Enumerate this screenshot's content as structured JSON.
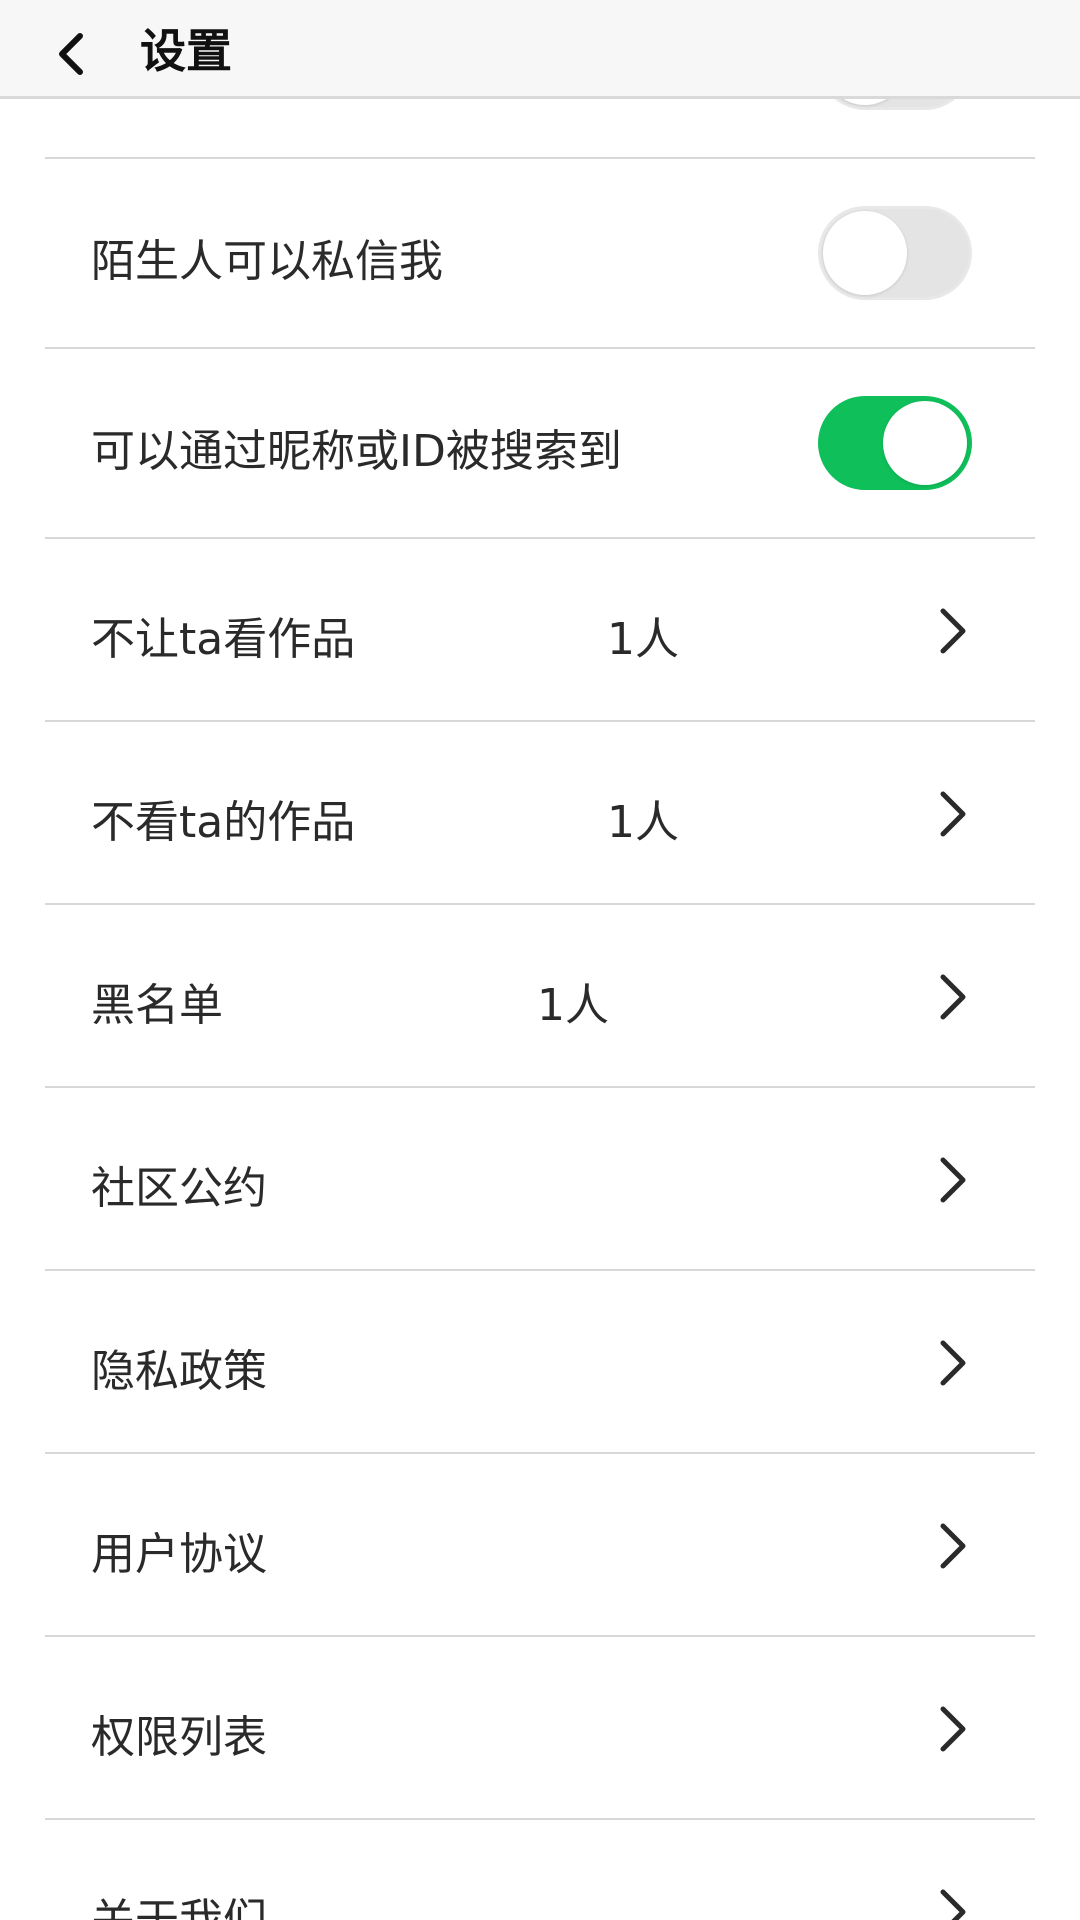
{
  "header": {
    "title": "设置"
  },
  "rows": {
    "stranger_dm": {
      "label": "陌生人可以私信我",
      "toggle": "off"
    },
    "searchable": {
      "label": "可以通过昵称或ID被搜索到",
      "toggle": "on"
    },
    "hide_works": {
      "label": "不让ta看作品",
      "value": "1人"
    },
    "not_see": {
      "label": "不看ta的作品",
      "value": "1人"
    },
    "blacklist": {
      "label": "黑名单",
      "value": "1人"
    },
    "community": {
      "label": "社区公约"
    },
    "privacy": {
      "label": "隐私政策"
    },
    "user_agreement": {
      "label": "用户协议"
    },
    "permissions": {
      "label": "权限列表"
    },
    "about": {
      "label": "关于我们"
    }
  },
  "colors": {
    "toggle_on": "#0fbf5a",
    "toggle_off": "#e4e4e4",
    "divider": "#d8d8d8",
    "header_bg": "#f7f7f7"
  },
  "icons": {
    "back": "chevron-left-icon",
    "row_arrow": "chevron-right-icon"
  }
}
